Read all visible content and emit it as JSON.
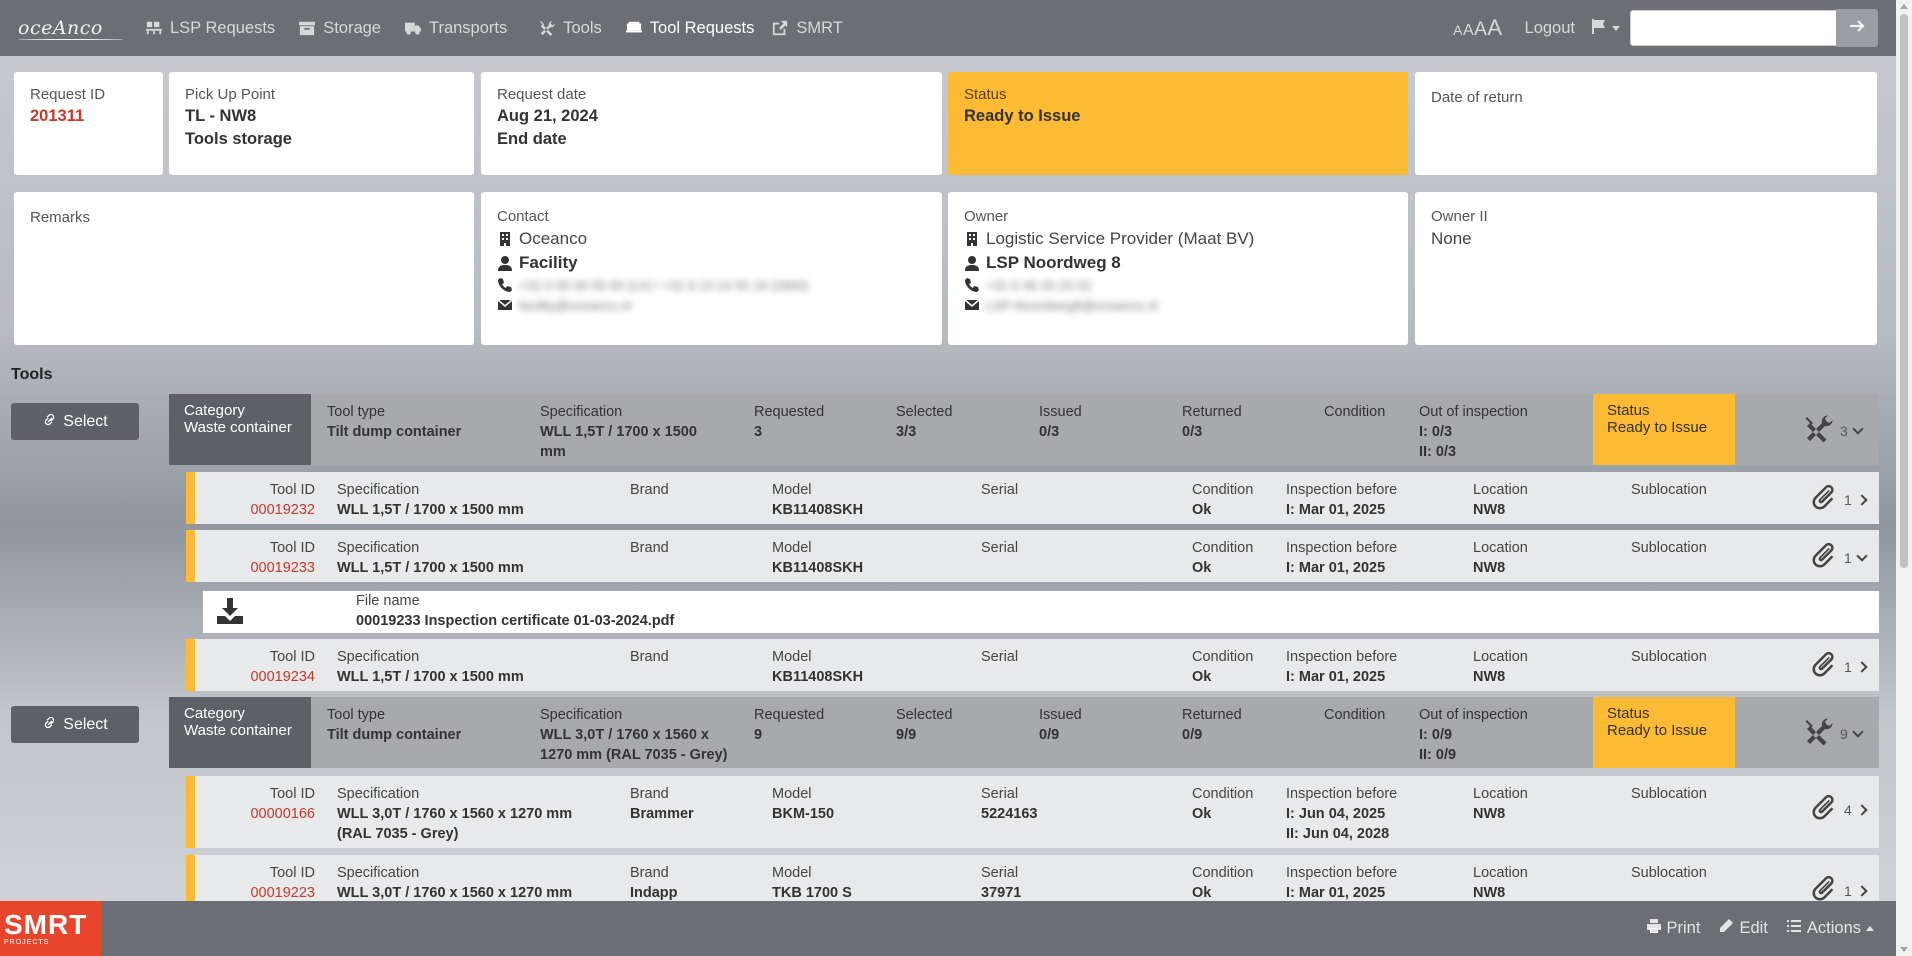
{
  "nav": {
    "brand": "oceAnco",
    "items": [
      {
        "label": "LSP Requests",
        "icon": "pallet-icon"
      },
      {
        "label": "Storage",
        "icon": "archive-icon"
      },
      {
        "label": "Transports",
        "icon": "truck-icon"
      },
      {
        "label": "Tools",
        "icon": "tools-icon"
      },
      {
        "label": "Tool Requests",
        "icon": "cart-icon",
        "active": true
      },
      {
        "label": "SMRT",
        "icon": "external-link-icon"
      }
    ],
    "font_sizes": [
      "A",
      "A",
      "A",
      "A"
    ],
    "logout": "Logout",
    "search_placeholder": ""
  },
  "request": {
    "id_label": "Request ID",
    "id": "201311",
    "pickup_label": "Pick Up Point",
    "pickup_code": "TL - NW8",
    "pickup_name": "Tools storage",
    "date_label": "Request date",
    "date": "Aug 21, 2024",
    "end_date_label": "End date",
    "status_label": "Status",
    "status": "Ready to Issue",
    "return_label": "Date of return",
    "remarks_label": "Remarks",
    "contact_label": "Contact",
    "contact_company": "Oceanco",
    "contact_name": "Facility",
    "contact_phone": "+31 0 00 00 00 00 (LV) / +31 6 13 14 55 19 (2900)",
    "contact_email": "facility@oceanco.nl",
    "owner_label": "Owner",
    "owner_company": "Logistic Service Provider (Maat BV)",
    "owner_name": "LSP Noordweg 8",
    "owner_phone": "+31 6 46 25 23 02",
    "owner_email": "LSP-Noordweg8@oceanco.nl",
    "owner2_label": "Owner II",
    "owner2": "None"
  },
  "tools": {
    "title": "Tools",
    "select_label": "Select",
    "groups": [
      {
        "category_label": "Category",
        "category": "Waste container",
        "tooltype_label": "Tool type",
        "tooltype": "Tilt dump container",
        "spec_label": "Specification",
        "spec_l1": "WLL 1,5T / 1700 x 1500",
        "spec_l2": "mm",
        "requested_label": "Requested",
        "requested": "3",
        "selected_label": "Selected",
        "selected": "3/3",
        "issued_label": "Issued",
        "issued": "0/3",
        "returned_label": "Returned",
        "returned": "0/3",
        "condition_label": "Condition",
        "ooi_label": "Out of inspection",
        "ooi_1": "I: 0/3",
        "ooi_2": "II: 0/3",
        "status_label": "Status",
        "status": "Ready to Issue",
        "count": "3"
      },
      {
        "category_label": "Category",
        "category": "Waste container",
        "tooltype_label": "Tool type",
        "tooltype": "Tilt dump container",
        "spec_label": "Specification",
        "spec_l1": "WLL 3,0T / 1760 x 1560 x",
        "spec_l2": "1270 mm (RAL 7035 - Grey)",
        "requested_label": "Requested",
        "requested": "9",
        "selected_label": "Selected",
        "selected": "9/9",
        "issued_label": "Issued",
        "issued": "0/9",
        "returned_label": "Returned",
        "returned": "0/9",
        "condition_label": "Condition",
        "ooi_label": "Out of inspection",
        "ooi_1": "I: 0/9",
        "ooi_2": "II: 0/9",
        "status_label": "Status",
        "status": "Ready to Issue",
        "count": "9"
      }
    ],
    "labels": {
      "tool_id": "Tool ID",
      "specification": "Specification",
      "brand": "Brand",
      "model": "Model",
      "serial": "Serial",
      "condition": "Condition",
      "inspection": "Inspection before",
      "location": "Location",
      "sublocation": "Sublocation",
      "file_name": "File name"
    },
    "items": [
      {
        "id": "00019232",
        "spec_l1": "WLL 1,5T / 1700 x 1500 mm",
        "spec_l2": "",
        "brand": "",
        "model": "KB11408SKH",
        "serial": "",
        "condition": "Ok",
        "insp_1": "I: Mar 01, 2025",
        "insp_2": "",
        "location": "NW8",
        "sublocation": "",
        "attachments": "1"
      },
      {
        "id": "00019233",
        "spec_l1": "WLL 1,5T / 1700 x 1500 mm",
        "spec_l2": "",
        "brand": "",
        "model": "KB11408SKH",
        "serial": "",
        "condition": "Ok",
        "insp_1": "I: Mar 01, 2025",
        "insp_2": "",
        "location": "NW8",
        "sublocation": "",
        "attachments": "1"
      },
      {
        "id": "00019234",
        "spec_l1": "WLL 1,5T / 1700 x 1500 mm",
        "spec_l2": "",
        "brand": "",
        "model": "KB11408SKH",
        "serial": "",
        "condition": "Ok",
        "insp_1": "I: Mar 01, 2025",
        "insp_2": "",
        "location": "NW8",
        "sublocation": "",
        "attachments": "1"
      },
      {
        "id": "00000166",
        "spec_l1": "WLL 3,0T / 1760 x 1560 x 1270 mm",
        "spec_l2": "(RAL 7035 - Grey)",
        "brand": "Brammer",
        "model": "BKM-150",
        "serial": "5224163",
        "condition": "Ok",
        "insp_1": "I: Jun 04, 2025",
        "insp_2": "II: Jun 04, 2028",
        "location": "NW8",
        "sublocation": "",
        "attachments": "4"
      },
      {
        "id": "00019223",
        "spec_l1": "WLL 3,0T / 1760 x 1560 x 1270 mm",
        "spec_l2": "",
        "brand": "Indapp",
        "model": "TKB 1700 S",
        "serial": "37971",
        "condition": "Ok",
        "insp_1": "I: Mar 01, 2025",
        "insp_2": "",
        "location": "NW8",
        "sublocation": "",
        "attachments": "1"
      }
    ],
    "file": {
      "name": "00019233 Inspection certificate 01-03-2024.pdf"
    }
  },
  "footer": {
    "logo_big": "SMRT",
    "logo_small": "PROJECTS",
    "print": "Print",
    "edit": "Edit",
    "actions": "Actions"
  },
  "colors": {
    "navbar": "#6b6f74",
    "status_yellow": "#fdba34",
    "id_red": "#c0392b",
    "category_dark": "#5d6166",
    "smrt_red": "#e8452c"
  }
}
